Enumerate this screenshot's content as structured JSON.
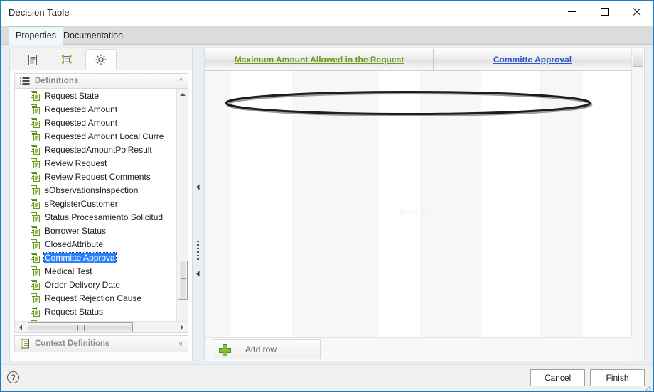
{
  "window": {
    "title": "Decision Table",
    "controls": {
      "minimize": "minimize",
      "maximize": "maximize",
      "close": "close"
    }
  },
  "tabs": [
    {
      "label": "Properties",
      "active": true
    },
    {
      "label": "Documentation",
      "active": false
    }
  ],
  "left_panel": {
    "icon_tabs": [
      {
        "name": "document-icon",
        "selected": false
      },
      {
        "name": "diagram-shapes-icon",
        "selected": false
      },
      {
        "name": "gear-icon",
        "selected": true
      }
    ],
    "definitions_section": {
      "label": "Definitions",
      "icon": "list-lines-icon",
      "collapse_icon": "chevron-up-icon"
    },
    "items": [
      {
        "label": "Request State",
        "selected": false
      },
      {
        "label": "Requested Amount",
        "selected": false
      },
      {
        "label": "Requested Amount",
        "selected": false
      },
      {
        "label": "Requested Amount Local Curre",
        "selected": false
      },
      {
        "label": "RequestedAmountPolResult",
        "selected": false
      },
      {
        "label": "Review Request",
        "selected": false
      },
      {
        "label": "Review Request Comments",
        "selected": false
      },
      {
        "label": "sObservationsInspection",
        "selected": false
      },
      {
        "label": "sRegisterCustomer",
        "selected": false
      },
      {
        "label": "Status Procesamiento Solicitud",
        "selected": false
      },
      {
        "label": "Borrower Status",
        "selected": false
      },
      {
        "label": "ClosedAttribute",
        "selected": false
      },
      {
        "label": "Committe Approva",
        "selected": true
      },
      {
        "label": "Medical Test",
        "selected": false
      },
      {
        "label": "Order Delivery Date",
        "selected": false
      },
      {
        "label": "Request Rejection Cause",
        "selected": false
      },
      {
        "label": "Request Status",
        "selected": false
      },
      {
        "label": "Requested Amount Policy Resu",
        "selected": false
      }
    ],
    "context_section": {
      "label": "Context Definitions",
      "icon": "notebook-icon",
      "expand_icon": "chevron-down-icon"
    },
    "scrollbars": {
      "vertical": {
        "up_icon": "triangle-up-icon",
        "down_icon": "triangle-down-icon"
      },
      "horizontal": {
        "left_icon": "triangle-left-icon",
        "right_icon": "triangle-right-icon"
      }
    }
  },
  "splitter": {
    "collapse_left_top_icon": "triangle-left-icon",
    "collapse_left_bottom_icon": "triangle-left-icon"
  },
  "right_panel": {
    "columns": [
      {
        "label": "Maximum Amount Allowed in the Request",
        "color": "#6d9a1a",
        "type": "condition"
      },
      {
        "label": "Committe Approval",
        "color": "#2f57c9",
        "type": "conclusion"
      }
    ],
    "rows": [],
    "watermark": "panelEx1",
    "add_row_button": {
      "label": "Add row",
      "icon": "plus-icon"
    }
  },
  "annotation": {
    "shape": "ellipse",
    "color": "#1d1d1d",
    "targets": [
      "Maximum Amount Allowed in the Request",
      "Committe Approval"
    ]
  },
  "footer": {
    "help_icon": "question-mark-icon",
    "help_label": "?",
    "buttons": [
      {
        "label": "Cancel",
        "name": "cancel-button"
      },
      {
        "label": "Finish",
        "name": "finish-button"
      }
    ]
  },
  "colors": {
    "accent": "#1a7dc4",
    "selection": "#2a7fff",
    "condition_green": "#6d9a1a",
    "conclusion_blue": "#2f57c9",
    "plus_green": "#7bc043"
  }
}
